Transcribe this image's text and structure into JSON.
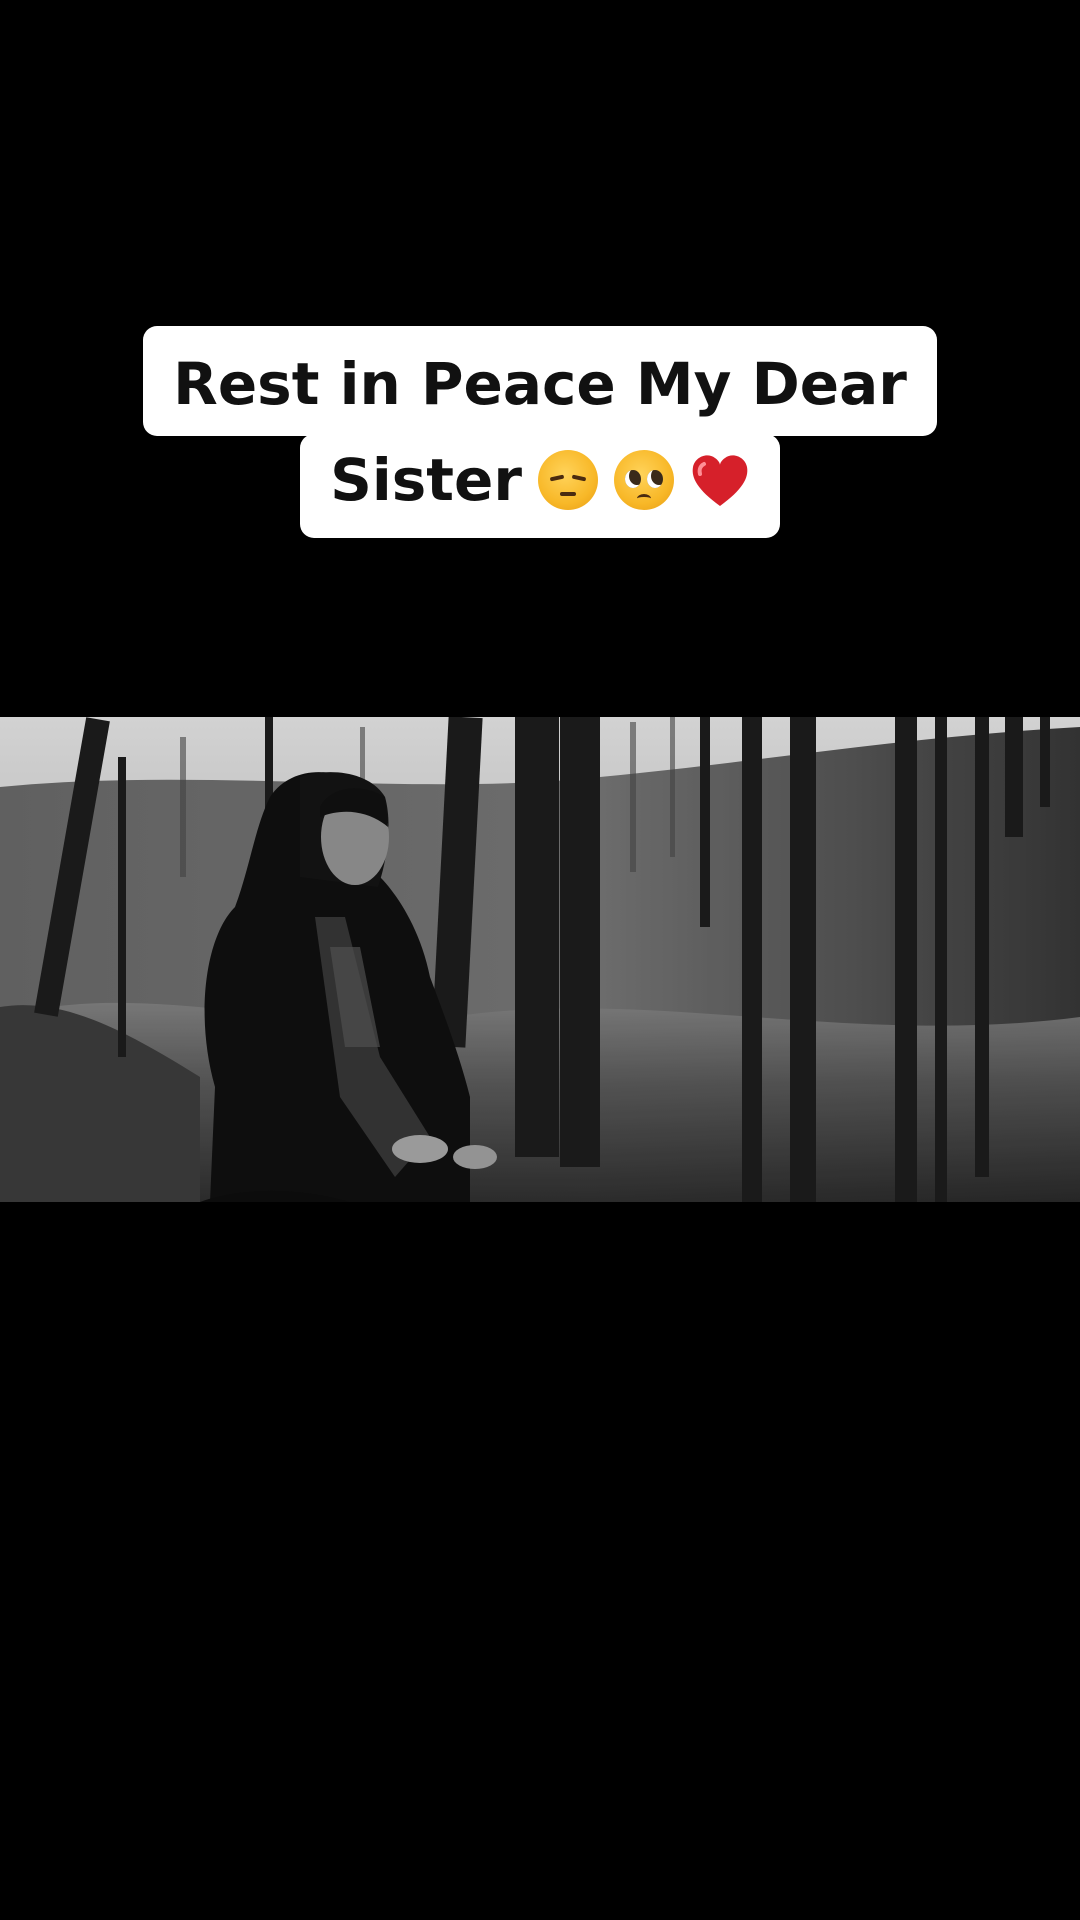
{
  "caption": {
    "line1": "Rest in Peace My Dear",
    "line2": "Sister",
    "emojis": [
      "pensive-face",
      "pleading-face",
      "red-heart"
    ]
  },
  "video": {
    "description_icon": "video-frame",
    "tone": "black-and-white"
  },
  "colors": {
    "background": "#000000",
    "caption_bg": "#ffffff",
    "caption_text": "#111111",
    "heart": "#d6202a"
  }
}
